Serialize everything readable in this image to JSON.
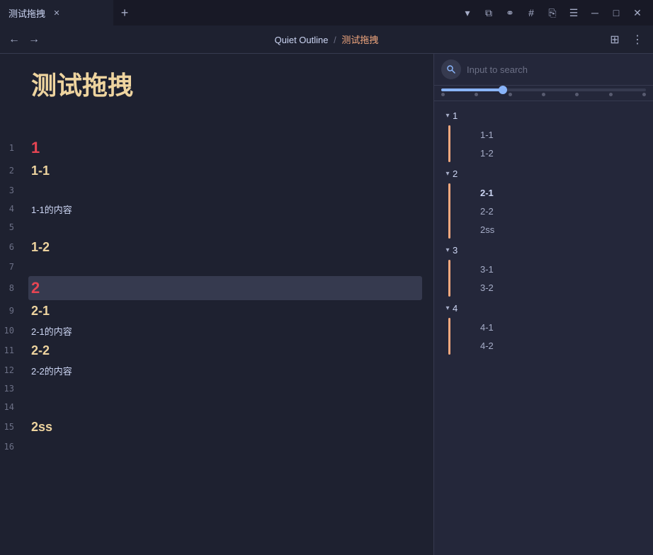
{
  "titleBar": {
    "tabTitle": "测试拖拽",
    "newTabLabel": "+",
    "controls": {
      "dropdown": "▾",
      "layout": "⧉",
      "link": "⚭",
      "hash": "#",
      "copy": "⎘",
      "menu": "☰",
      "minimize": "─",
      "maximize": "□",
      "close": "✕"
    }
  },
  "navBar": {
    "backArrow": "←",
    "forwardArrow": "→",
    "breadcrumb1": "Quiet Outline",
    "separator": "/",
    "breadcrumb2": "测试拖拽",
    "layoutBtn": "⊞",
    "moreBtn": "⋮"
  },
  "editor": {
    "docTitle": "测试拖拽",
    "lines": [
      {
        "num": "1",
        "text": "1",
        "style": "heading1"
      },
      {
        "num": "2",
        "text": "1-1",
        "style": "heading2"
      },
      {
        "num": "3",
        "text": "",
        "style": "normal-text"
      },
      {
        "num": "4",
        "text": "1-1的内容",
        "style": "normal-text"
      },
      {
        "num": "5",
        "text": "",
        "style": "normal-text"
      },
      {
        "num": "6",
        "text": "1-2",
        "style": "heading2"
      },
      {
        "num": "7",
        "text": "",
        "style": "normal-text"
      },
      {
        "num": "8",
        "text": "2",
        "style": "heading1",
        "highlighted": true
      },
      {
        "num": "9",
        "text": "2-1",
        "style": "heading2"
      },
      {
        "num": "10",
        "text": "2-1的内容",
        "style": "normal-text"
      },
      {
        "num": "11",
        "text": "2-2",
        "style": "heading2"
      },
      {
        "num": "12",
        "text": "2-2的内容",
        "style": "normal-text"
      },
      {
        "num": "13",
        "text": "",
        "style": "normal-text"
      },
      {
        "num": "14",
        "text": "",
        "style": "normal-text"
      },
      {
        "num": "15",
        "text": "2ss",
        "style": "heading2"
      },
      {
        "num": "16",
        "text": "",
        "style": "normal-text"
      }
    ]
  },
  "sidebar": {
    "searchPlaceholder": "Input to search",
    "outline": [
      {
        "label": "1",
        "expanded": true,
        "children": [
          {
            "label": "1-1",
            "bold": false
          },
          {
            "label": "1-2",
            "bold": false
          }
        ]
      },
      {
        "label": "2",
        "expanded": true,
        "children": [
          {
            "label": "2-1",
            "bold": true
          },
          {
            "label": "2-2",
            "bold": false
          },
          {
            "label": "2ss",
            "bold": false
          }
        ]
      },
      {
        "label": "3",
        "expanded": true,
        "children": [
          {
            "label": "3-1",
            "bold": false
          },
          {
            "label": "3-2",
            "bold": false
          }
        ]
      },
      {
        "label": "4",
        "expanded": true,
        "children": [
          {
            "label": "4-1",
            "bold": false
          },
          {
            "label": "4-2",
            "bold": false
          }
        ]
      }
    ]
  }
}
